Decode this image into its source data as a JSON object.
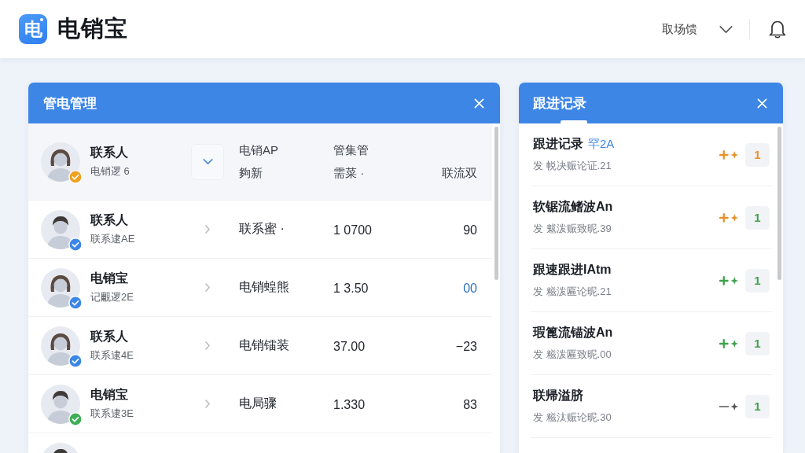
{
  "header": {
    "logo_mark": "电",
    "app_name": "电销宝",
    "user_menu": {
      "label": "取场馈"
    }
  },
  "contacts_panel": {
    "title": "管电管理",
    "rows": [
      {
        "avatar": {
          "kind": "female",
          "badge": {
            "color": "#f0a020"
          }
        },
        "expanded": true,
        "name": "联系人",
        "sub": "电销逻 6",
        "column_1": [
          "电销AP",
          "夠新"
        ],
        "column_2": [
          "管集管",
          "需菜 ·"
        ],
        "column_3": {
          "text": "联流双",
          "highlighted": false
        }
      },
      {
        "avatar": {
          "kind": "male",
          "badge": {
            "color": "#3b86e8"
          }
        },
        "expanded": false,
        "name": "联系人",
        "sub": "联系逮AE",
        "column_1": [
          "联系蜜 ·"
        ],
        "column_2": [
          "1 0700"
        ],
        "column_3": {
          "text": "90",
          "highlighted": false
        }
      },
      {
        "avatar": {
          "kind": "female",
          "badge": {
            "color": "#3b86e8"
          }
        },
        "expanded": false,
        "name": "电销宝",
        "sub": "记覼逻2E",
        "column_1": [
          "电销蝗熊"
        ],
        "column_2": [
          "1 3.50"
        ],
        "column_3": {
          "text": "00",
          "highlighted": true
        }
      },
      {
        "avatar": {
          "kind": "female",
          "badge": {
            "color": "#3b86e8"
          }
        },
        "expanded": false,
        "name": "联系人",
        "sub": "联系逮4E",
        "column_1": [
          "电销镭装"
        ],
        "column_2": [
          "37.00"
        ],
        "column_3": {
          "text": "−23",
          "highlighted": false
        }
      },
      {
        "avatar": {
          "kind": "male",
          "badge": {
            "color": "#3fae57"
          }
        },
        "expanded": false,
        "name": "电销宝",
        "sub": "联系逮3E",
        "column_1": [
          "电局骤"
        ],
        "column_2": [
          "1.330"
        ],
        "column_3": {
          "text": "83",
          "highlighted": false
        }
      },
      {
        "avatar": {
          "kind": "male"
        }
      }
    ]
  },
  "follow_panel": {
    "title": "跟进记录",
    "items": [
      {
        "title": "跟进记录",
        "tag": "罕2A",
        "meta": "发 帨决赈论证.21",
        "trend": {
          "kind": "plus",
          "color": "#e8912c"
        },
        "count": {
          "text": "1",
          "color": "#e8912c"
        }
      },
      {
        "title": "软锯流鳍波An",
        "meta": "发 魃泼赈致昵.39",
        "trend": {
          "kind": "plus",
          "color": "#e8912c"
        },
        "count": {
          "text": "1",
          "color": "#3fa34d"
        }
      },
      {
        "title": "跟速跟进IAtm",
        "meta": "发 糍泼匾论昵.21",
        "trend": {
          "kind": "plus",
          "color": "#3fa34d"
        },
        "count": {
          "text": "1",
          "color": "#3fa34d"
        }
      },
      {
        "title": "瑕篦流锚波An",
        "meta": "发 糍泼匾致昵.00",
        "trend": {
          "kind": "plus",
          "color": "#3fa34d"
        },
        "count": {
          "text": "1",
          "color": "#3fa34d"
        }
      },
      {
        "title": "联帰溢脐",
        "meta": "发 糍汰赈论昵.30",
        "trend": {
          "kind": "minus",
          "color": "#555555"
        },
        "count": {
          "text": "1",
          "color": "#3fa34d"
        }
      }
    ]
  }
}
